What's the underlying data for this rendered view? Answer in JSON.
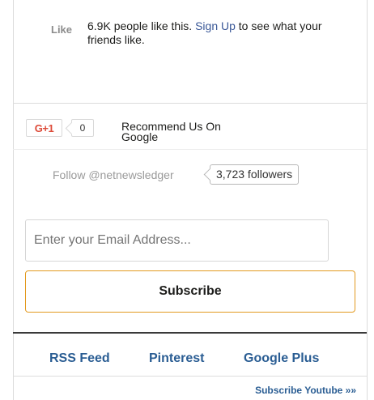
{
  "facebook": {
    "like_label": "Like",
    "count_text": "6.9K people like this.",
    "signup_link": "Sign Up",
    "rest_text": "to see what your friends like."
  },
  "google_plus": {
    "button_label": "G+1",
    "count": "0",
    "recommend_text": "Recommend Us On Google"
  },
  "twitter": {
    "follow_text": "Follow @netnewsledger",
    "followers": "3,723 followers"
  },
  "email": {
    "placeholder": "Enter your Email Address...",
    "subscribe_label": "Subscribe"
  },
  "links": {
    "rss": "RSS Feed",
    "pinterest": "Pinterest",
    "google_plus": "Google Plus",
    "youtube": "Subscribe Youtube »»"
  },
  "colors": {
    "link_blue": "#2a5d93",
    "subscribe_border": "#e39a1f",
    "gplus_red": "#dd4b39"
  }
}
